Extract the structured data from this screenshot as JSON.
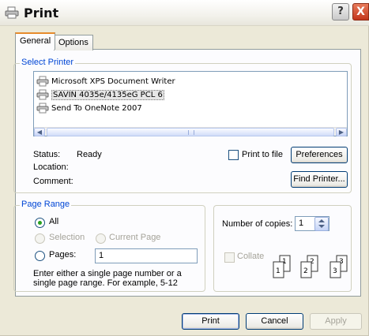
{
  "window": {
    "title": "Print",
    "help_glyph": "?",
    "close_glyph": "X"
  },
  "tabs": [
    {
      "label": "General",
      "active": true
    },
    {
      "label": "Options",
      "active": false
    }
  ],
  "select_printer": {
    "legend": "Select Printer",
    "printers": [
      {
        "name": "Microsoft XPS Document Writer",
        "selected": false
      },
      {
        "name": "SAVIN 4035e/4135eG PCL 6",
        "selected": true
      },
      {
        "name": "Send To OneNote 2007",
        "selected": false
      }
    ],
    "status_label": "Status:",
    "status_value": "Ready",
    "location_label": "Location:",
    "comment_label": "Comment:",
    "print_to_file_label": "Print to file",
    "preferences_label": "Preferences",
    "find_printer_label": "Find Printer..."
  },
  "page_range": {
    "legend": "Page Range",
    "all_label": "All",
    "selection_label": "Selection",
    "current_page_label": "Current Page",
    "pages_label": "Pages:",
    "pages_value": "1",
    "hint": "Enter either a single page number or a single page range.  For example, 5-12"
  },
  "copies": {
    "number_label": "Number of copies:",
    "number_value": "1",
    "collate_label": "Collate",
    "collate_digits": [
      "1",
      "1",
      "2",
      "2",
      "3",
      "3"
    ]
  },
  "footer": {
    "print_label": "Print",
    "cancel_label": "Cancel",
    "apply_label": "Apply"
  },
  "colors": {
    "accent": "#0046d5",
    "tab_highlight": "#e68b2c",
    "close": "#c2351a"
  }
}
